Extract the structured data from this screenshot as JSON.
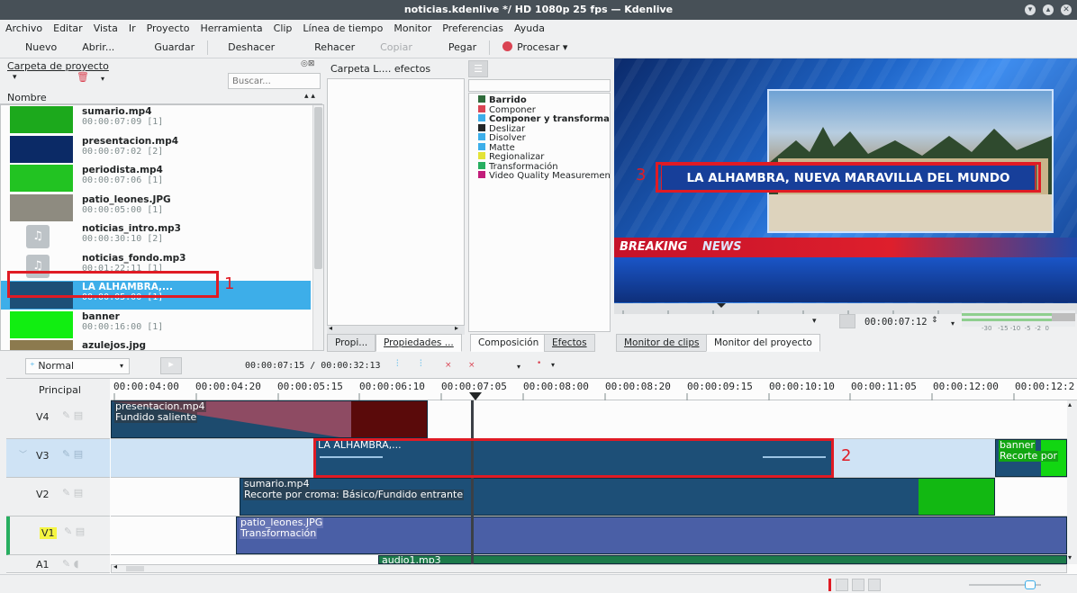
{
  "window": {
    "title": "noticias.kdenlive */ HD 1080p 25 fps — Kdenlive"
  },
  "menu": [
    "Archivo",
    "Editar",
    "Vista",
    "Ir",
    "Proyecto",
    "Herramienta",
    "Clip",
    "Línea de tiempo",
    "Monitor",
    "Preferencias",
    "Ayuda"
  ],
  "toolbar": {
    "nuevo": "Nuevo",
    "abrir": "Abrir...",
    "guardar": "Guardar",
    "deshacer": "Deshacer",
    "rehacer": "Rehacer",
    "copiar": "Copiar",
    "pegar": "Pegar",
    "procesar": "Procesar"
  },
  "bin": {
    "title": "Carpeta de proyecto",
    "search_placeholder": "Buscar...",
    "column": "Nombre",
    "items": [
      {
        "name": "sumario.mp4",
        "dur": "00:00:07:09 [1]",
        "thumb": "#1ca91c"
      },
      {
        "name": "presentacion.mp4",
        "dur": "00:00:07:02 [2]",
        "thumb": "#0b2a66"
      },
      {
        "name": "periodista.mp4",
        "dur": "00:00:07:06 [1]",
        "thumb": "#22c322"
      },
      {
        "name": "patio_leones.JPG",
        "dur": "00:00:05:00 [1]",
        "thumb": "#8e8b80"
      },
      {
        "name": "noticias_intro.mp3",
        "dur": "00:00:30:10 [2]",
        "thumb": "audio"
      },
      {
        "name": "noticias_fondo.mp3",
        "dur": "00:01:22:11 [1]",
        "thumb": "audio"
      },
      {
        "name": "LA ALHAMBRA,...",
        "dur": "00:00:05:00 [1]",
        "thumb": "#1d4f77"
      },
      {
        "name": "banner",
        "dur": "00:00:16:00 [1]",
        "thumb": "#11ee11"
      },
      {
        "name": "azulejos.jpg",
        "dur": "00:00:05:00 [1]",
        "thumb": "#8c7a4e"
      }
    ]
  },
  "library": {
    "title": "Carpeta L.... efectos"
  },
  "effects": [
    {
      "label": "Barrido",
      "color": "#2e6b3a",
      "bold": true
    },
    {
      "label": "Componer",
      "color": "#da4453",
      "bold": false
    },
    {
      "label": "Componer y transformar",
      "color": "#3daee9",
      "bold": true
    },
    {
      "label": "Deslizar",
      "color": "#232627",
      "bold": false
    },
    {
      "label": "Disolver",
      "color": "#3daee9",
      "bold": false
    },
    {
      "label": "Matte",
      "color": "#3daee9",
      "bold": false
    },
    {
      "label": "Regionalizar",
      "color": "#e3e337",
      "bold": false
    },
    {
      "label": "Transformación",
      "color": "#27ae60",
      "bold": false
    },
    {
      "label": "Video Quality Measurement",
      "color": "#c21d7a",
      "bold": false
    }
  ],
  "tabs": {
    "propi": "Propi...",
    "propiedades": "Propiedades ...",
    "composicion": "Composición",
    "efectos": "Efectos",
    "monitor_clips": "Monitor de clips",
    "monitor_proyecto": "Monitor del proyecto"
  },
  "monitor": {
    "headline": "LA ALHAMBRA, NUEVA MARAVILLA DEL MUNDO",
    "breaking": "BREAKING",
    "news": "NEWS",
    "timecode": "00:00:07:12",
    "meter_labels": "-30   -15 -10  -5  -2  0"
  },
  "timeline": {
    "mode": "Normal",
    "position": "00:00:07:15 / 00:00:32:13",
    "principal": "Principal",
    "ruler": [
      "00:00:04:00",
      "00:00:04:20",
      "00:00:05:15",
      "00:00:06:10",
      "00:00:07:05",
      "00:00:08:00",
      "00:00:08:20",
      "00:00:09:15",
      "00:00:10:10",
      "00:00:11:05",
      "00:00:12:00",
      "00:00:12:2"
    ],
    "tracks": [
      "V4",
      "V3",
      "V2",
      "V1",
      "A1"
    ],
    "clips": {
      "presentacion": "presentacion.mp4",
      "fundido": "Fundido saliente",
      "alhambra": "LA ALHAMBRA,...",
      "banner": "banner",
      "recorte": "Recorte por",
      "sumario": "sumario.mp4",
      "croma": "Recorte por croma: Básico/Fundido entrante",
      "patio": "patio_leones.JPG",
      "transformacion": "Transformación",
      "audio": "audio1.mp3"
    }
  },
  "annotations": [
    "1",
    "2",
    "3"
  ]
}
